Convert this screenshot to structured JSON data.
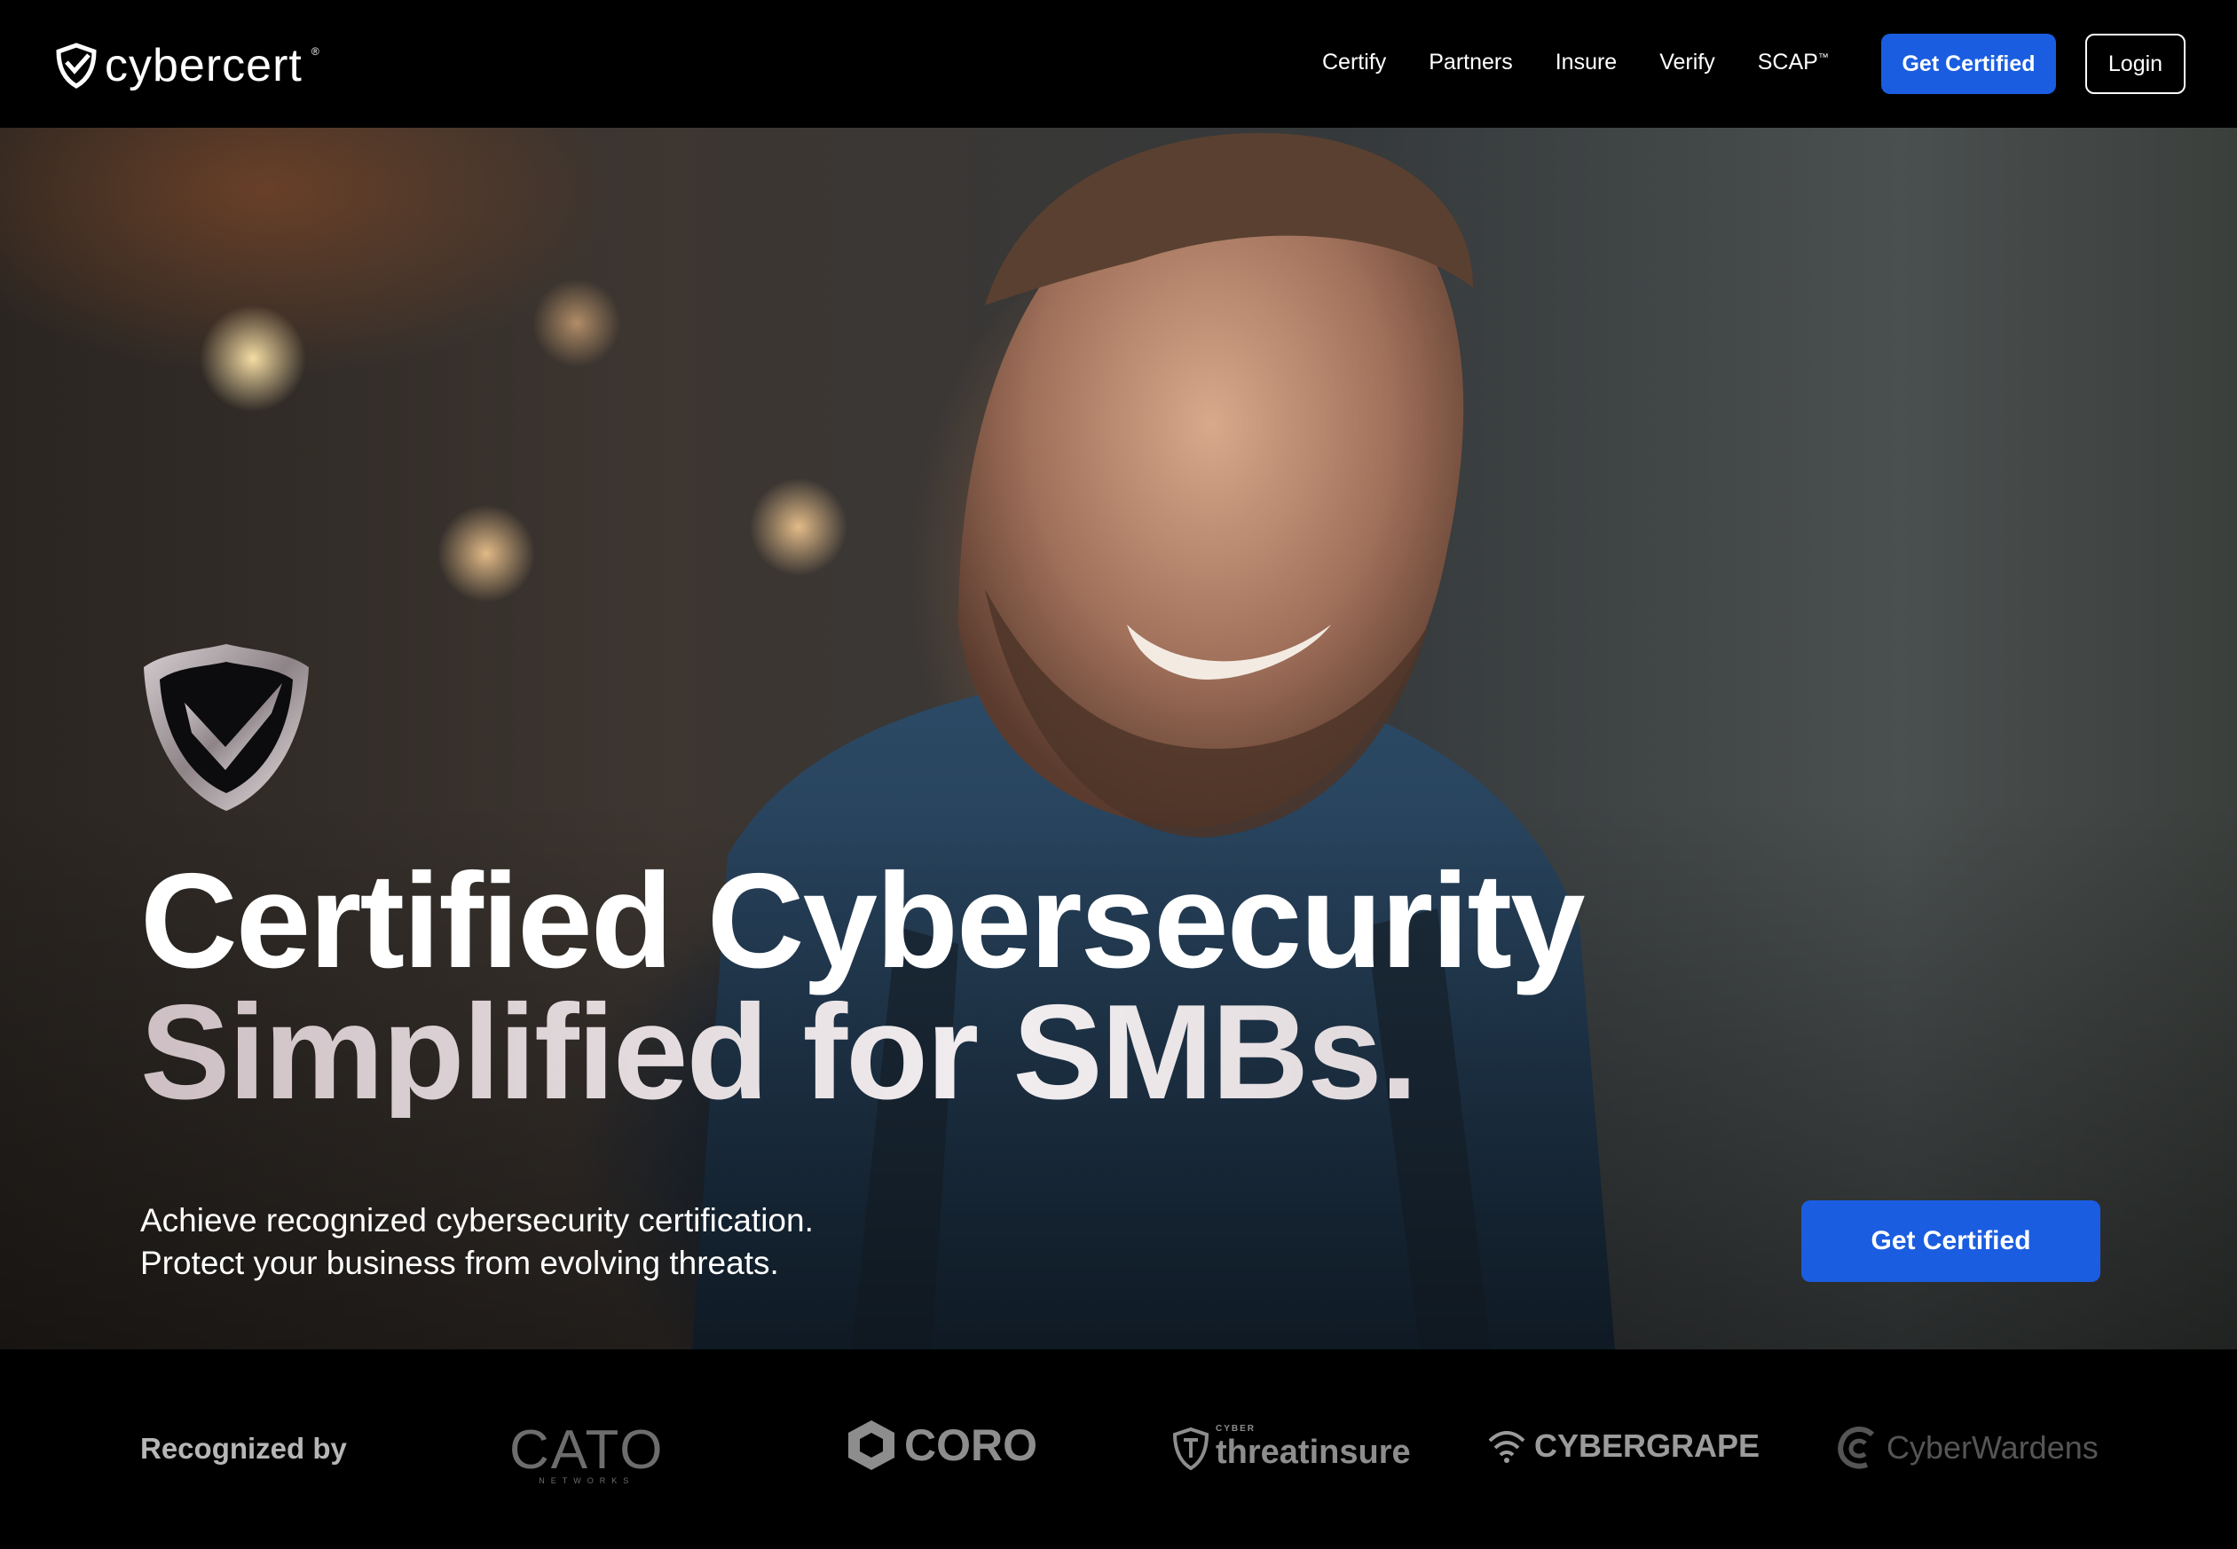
{
  "brand": {
    "name": "cybercert",
    "reg": "®"
  },
  "nav": {
    "links": [
      "Certify",
      "Partners",
      "Insure",
      "Verify",
      "SCAP"
    ],
    "scap_mark": "™",
    "cta": "Get Certified",
    "login": "Login"
  },
  "hero": {
    "headline_line1": "Certified Cybersecurity",
    "headline_line2": "Simplified for SMBs.",
    "sub_line1": "Achieve recognized cybersecurity certification.",
    "sub_line2": "Protect your business from evolving threats.",
    "cta": "Get Certified"
  },
  "recognized": {
    "label": "Recognized by",
    "partners": {
      "cato": "CATO",
      "cato_sub": "NETWORKS",
      "coro": "CORO",
      "threat_small": "CYBER",
      "threat": "threatinsure",
      "grape": "CYBERGRAPE",
      "warden": "CyberWardens"
    }
  },
  "colors": {
    "accent": "#1a5de0",
    "bg": "#000000"
  }
}
